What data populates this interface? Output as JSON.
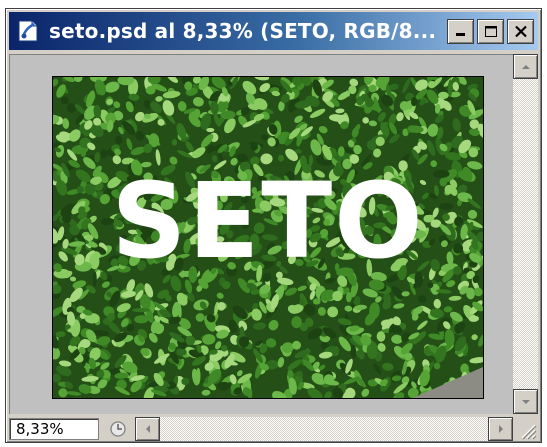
{
  "window": {
    "title": "seto.psd al 8,33% (SETO, RGB/8..."
  },
  "canvas": {
    "overlay_text": "SETO"
  },
  "status": {
    "zoom": "8,33%"
  },
  "colors": {
    "titlebar_start": "#0a246a",
    "titlebar_end": "#a6caf0",
    "chrome": "#d4d0c8",
    "foliage": "#2f6b1e"
  },
  "icons": {
    "app": "photoshop-document-icon",
    "minimize": "minimize-icon",
    "maximize": "maximize-icon",
    "close": "close-icon",
    "scroll_up": "arrow-up-icon",
    "scroll_down": "arrow-down-icon",
    "scroll_left": "arrow-left-icon",
    "scroll_right": "arrow-right-icon",
    "status_menu": "status-menu-icon",
    "resize": "resize-grip-icon"
  }
}
